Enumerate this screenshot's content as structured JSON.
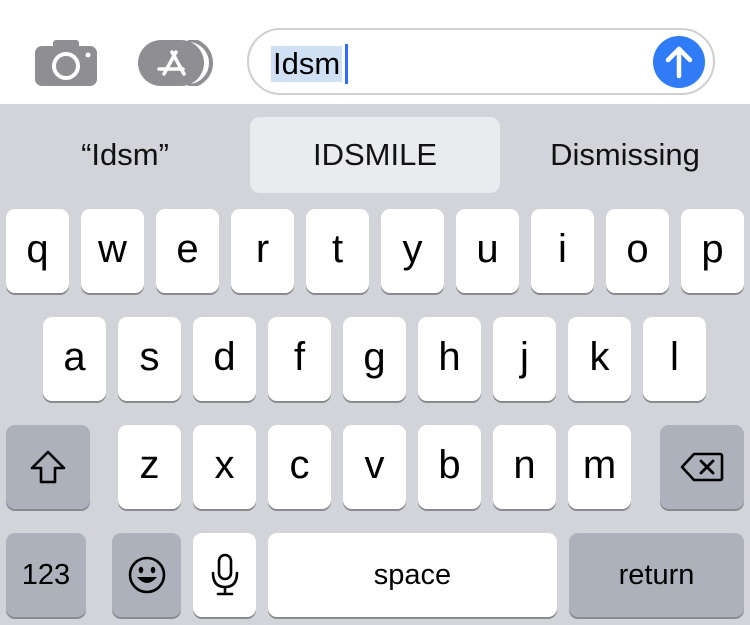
{
  "compose": {
    "text": "Idsm"
  },
  "suggestions": [
    "“Idsm”",
    "IDSMILE",
    "Dismissing"
  ],
  "keyboard": {
    "row1": [
      "q",
      "w",
      "e",
      "r",
      "t",
      "y",
      "u",
      "i",
      "o",
      "p"
    ],
    "row2": [
      "a",
      "s",
      "d",
      "f",
      "g",
      "h",
      "j",
      "k",
      "l"
    ],
    "row3": [
      "z",
      "x",
      "c",
      "v",
      "b",
      "n",
      "m"
    ],
    "numbers_label": "123",
    "space_label": "space",
    "return_label": "return"
  },
  "icons": {
    "camera": "camera-icon",
    "app_store": "app-store-icon",
    "send": "send-arrow-icon",
    "shift": "shift-icon",
    "delete": "delete-icon",
    "emoji": "emoji-icon",
    "dictation": "microphone-icon"
  },
  "colors": {
    "accent": "#2f7cf6",
    "keyboard_bg": "#d2d4da",
    "function_key": "#acb1bb",
    "selection": "#cfe0f5"
  }
}
